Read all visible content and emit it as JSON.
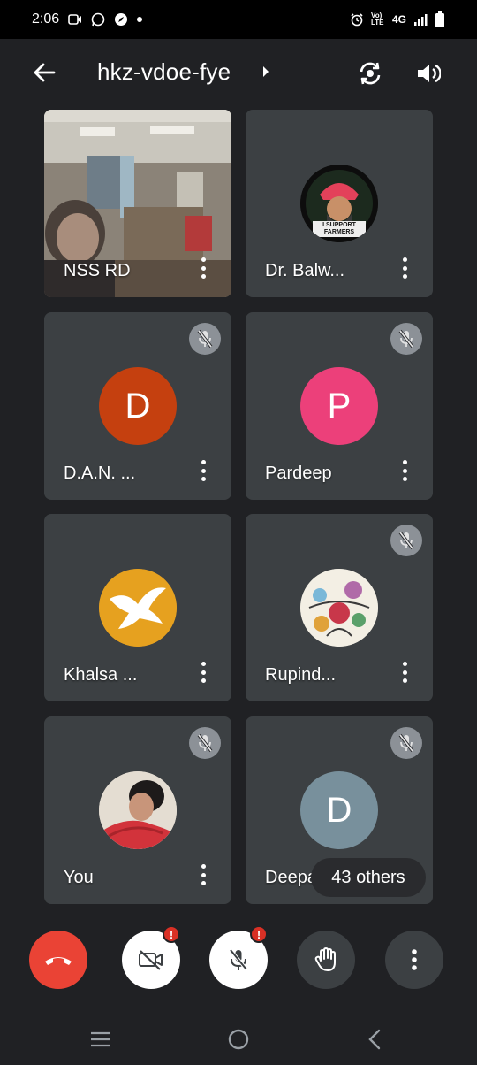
{
  "status_bar": {
    "time": "2:06",
    "network": "4G",
    "volte": "Vo) LTE"
  },
  "meeting": {
    "code": "hkz-vdoe-fye"
  },
  "participants": [
    {
      "name": "NSS RD",
      "type": "video",
      "muted": false
    },
    {
      "name": "Dr. Balw...",
      "type": "image",
      "muted": false,
      "badge_text": "I SUPPORT FARMERS"
    },
    {
      "name": "D.A.N. ...",
      "type": "initial",
      "initial": "D",
      "color": "#c5400f",
      "muted": true
    },
    {
      "name": "Pardeep",
      "type": "initial",
      "initial": "P",
      "color": "#ec407a",
      "muted": true
    },
    {
      "name": "Khalsa ...",
      "type": "image",
      "muted": false
    },
    {
      "name": "Rupind...",
      "type": "image",
      "muted": true
    },
    {
      "name": "You",
      "type": "image",
      "muted": true
    },
    {
      "name": "Deepa",
      "type": "initial",
      "initial": "D",
      "color": "#78909c",
      "muted": true
    }
  ],
  "others_chip": "43 others",
  "controls": {
    "end_call": "end-call-icon",
    "camera_badge": "!",
    "mic_badge": "!",
    "raise_hand": "hand-icon",
    "more": "more-vertical-icon"
  },
  "colors": {
    "background": "#202124",
    "tile": "#3c4043",
    "end_call": "#ea4335",
    "control_active": "#ffffff",
    "control_dark": "#3c4043"
  }
}
